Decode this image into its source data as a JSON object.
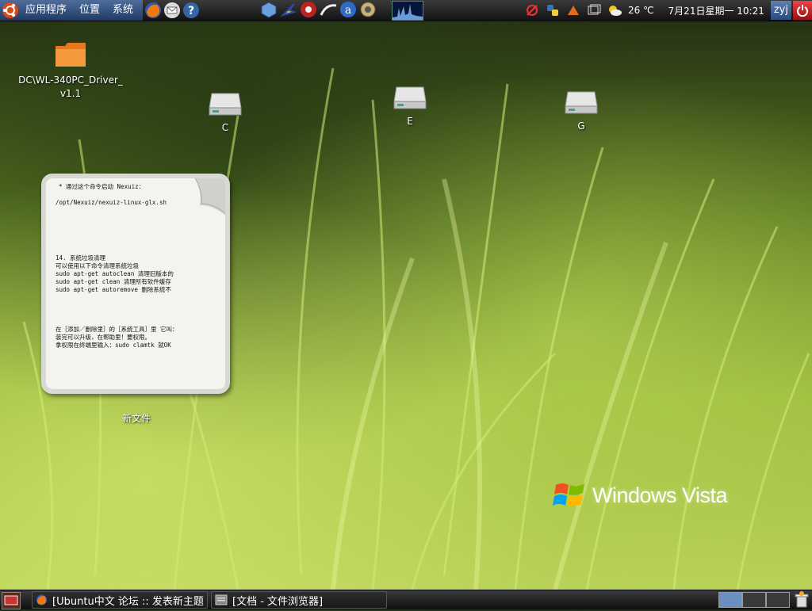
{
  "top_panel": {
    "menu": [
      "应用程序",
      "位置",
      "系统"
    ],
    "launchers_left": [
      "firefox-icon",
      "mail-icon",
      "help-icon"
    ],
    "launchers_center": [
      "virtualbox-icon",
      "deluge-icon",
      "media-icon",
      "terminal-swoosh-icon",
      "amarok-icon",
      "settings-icon"
    ],
    "weather": "26 ℃",
    "datetime": "7月21日星期一 10:21",
    "user": "zyj"
  },
  "desktop_icons": {
    "folder": {
      "label_line1": "DC\\WL-340PC_Driver_",
      "label_line2": "v1.1"
    },
    "drives": [
      {
        "label": "C"
      },
      {
        "label": "E"
      },
      {
        "label": "G"
      }
    ]
  },
  "note": {
    "caption": "新文件",
    "lines": [
      "  * 通过这个命令启动 Nexuiz：",
      "",
      "/opt/Nexuiz/nexuiz-linux-glx.sh",
      "14. 系统垃圾清理",
      "可以使用以下命令清理系统垃圾",
      "sudo apt-get autoclean 清理旧版本的",
      "sudo apt-get clean 清理所有软件缓存",
      "sudo apt-get autoremove 删除系统不",
      "在［添加／删除里］的［系统工具］里 它叫：",
      "装完可以升级，在帮助里！要权限。",
      "拿权限在终端里输入：sudo clamtk 就OK"
    ]
  },
  "vista_logo": {
    "text": "Windows Vista"
  },
  "taskbar": {
    "tasks": [
      {
        "label": "[Ubuntu中文 论坛 :: 发表新主题 ..."
      },
      {
        "label": "[文档 - 文件浏览器]"
      }
    ]
  },
  "colors": {
    "panel": "#1a1a1a",
    "menu_accent": "#3a5a8c",
    "grass": "#9bbb3c"
  }
}
